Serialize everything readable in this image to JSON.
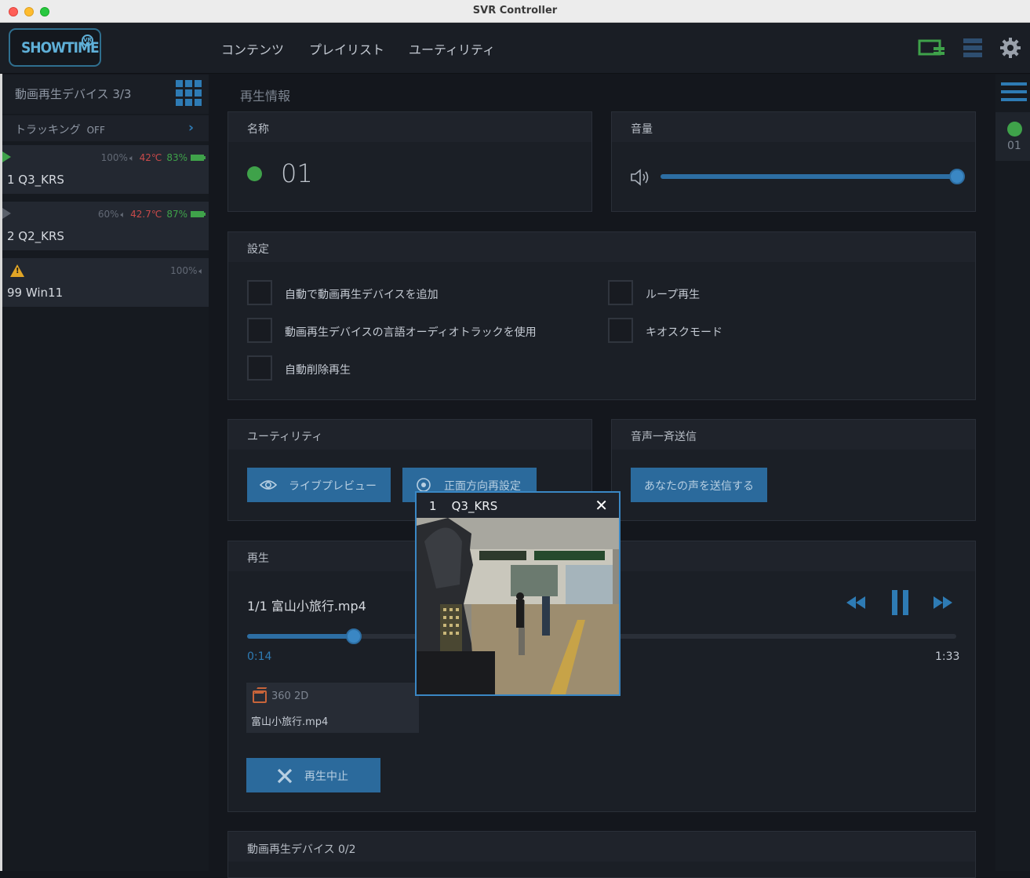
{
  "window": {
    "title": "SVR Controller"
  },
  "logo": {
    "text": "SHOWTIME",
    "badge": "VR"
  },
  "nav": {
    "items": [
      "コンテンツ",
      "プレイリスト",
      "ユーティリティ"
    ]
  },
  "icons": {
    "top_right": [
      "screens-icon",
      "server-icon",
      "gear-icon"
    ]
  },
  "sidebar": {
    "title": "動画再生デバイス 3/3",
    "tracking_label": "トラッキング",
    "tracking_value": "OFF",
    "devices": [
      {
        "name": "1 Q3_KRS",
        "volume": "100%",
        "temp": "42℃",
        "battery": "83%",
        "state": "playing"
      },
      {
        "name": "2 Q2_KRS",
        "volume": "60%",
        "temp": "42.7℃",
        "battery": "87%",
        "state": "paused"
      },
      {
        "name": "99 Win11",
        "volume": "100%",
        "temp": "",
        "battery": "",
        "state": "warning"
      }
    ]
  },
  "main": {
    "section_title": "再生情報",
    "name_card": {
      "title": "名称",
      "value": "01"
    },
    "volume_card": {
      "title": "音量",
      "level": 1.0
    },
    "settings": {
      "title": "設定",
      "options": [
        "自動で動画再生デバイスを追加",
        "動画再生デバイスの言語オーディオトラックを使用",
        "自動削除再生",
        "ループ再生",
        "キオスクモード"
      ]
    },
    "utility": {
      "title": "ユーティリティ",
      "live_preview": "ライブプレビュー",
      "recenter": "正面方向再設定"
    },
    "voice": {
      "title": "音声一斉送信",
      "button": "あなたの声を送信する"
    },
    "playback": {
      "title": "再生",
      "track": "1/1  富山小旅行.mp4",
      "elapsed": "0:14",
      "duration": "1:33",
      "progress": 0.15,
      "file_type": "360 2D",
      "file_name": "富山小旅行.mp4",
      "stop_label": "再生中止"
    },
    "devices_section": {
      "title": "動画再生デバイス 0/2"
    }
  },
  "rightbar": {
    "item_label": "01"
  },
  "popup": {
    "title": "1    Q3_KRS",
    "close": "✕"
  },
  "colors": {
    "accent": "#2e7bb4",
    "ok": "#3fa24a",
    "warn": "#e1a526",
    "hot": "#c84a4a"
  }
}
